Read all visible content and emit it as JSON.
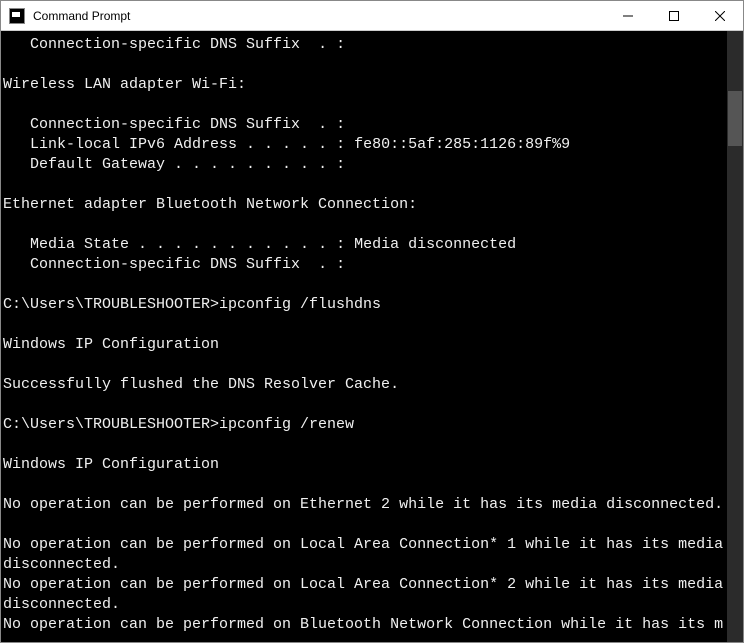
{
  "window": {
    "title": "Command Prompt"
  },
  "terminal": {
    "lines": [
      {
        "text": "   Connection-specific DNS Suffix  . :"
      },
      {
        "text": ""
      },
      {
        "text": "Wireless LAN adapter Wi-Fi:"
      },
      {
        "text": ""
      },
      {
        "text": "   Connection-specific DNS Suffix  . :"
      },
      {
        "text": "   Link-local IPv6 Address . . . . . : fe80::5af:285:1126:89f%9"
      },
      {
        "text": "   Default Gateway . . . . . . . . . :"
      },
      {
        "text": ""
      },
      {
        "text": "Ethernet adapter Bluetooth Network Connection:"
      },
      {
        "text": ""
      },
      {
        "text": "   Media State . . . . . . . . . . . : Media disconnected"
      },
      {
        "text": "   Connection-specific DNS Suffix  . :"
      },
      {
        "text": ""
      },
      {
        "text": "C:\\Users\\TROUBLESHOOTER>ipconfig /flushdns"
      },
      {
        "text": ""
      },
      {
        "text": "Windows IP Configuration"
      },
      {
        "text": ""
      },
      {
        "text": "Successfully flushed the DNS Resolver Cache."
      },
      {
        "text": ""
      },
      {
        "text": "C:\\Users\\TROUBLESHOOTER>ipconfig /renew"
      },
      {
        "text": ""
      },
      {
        "text": "Windows IP Configuration"
      },
      {
        "text": ""
      },
      {
        "text": "No operation can be performed on Ethernet 2 while it has its media disconnected."
      },
      {
        "text": ""
      },
      {
        "text": "No operation can be performed on Local Area Connection* 1 while it has its media disconnected."
      },
      {
        "text": "No operation can be performed on Local Area Connection* 2 while it has its media disconnected."
      },
      {
        "text": "No operation can be performed on Bluetooth Network Connection while it has its m"
      }
    ]
  }
}
